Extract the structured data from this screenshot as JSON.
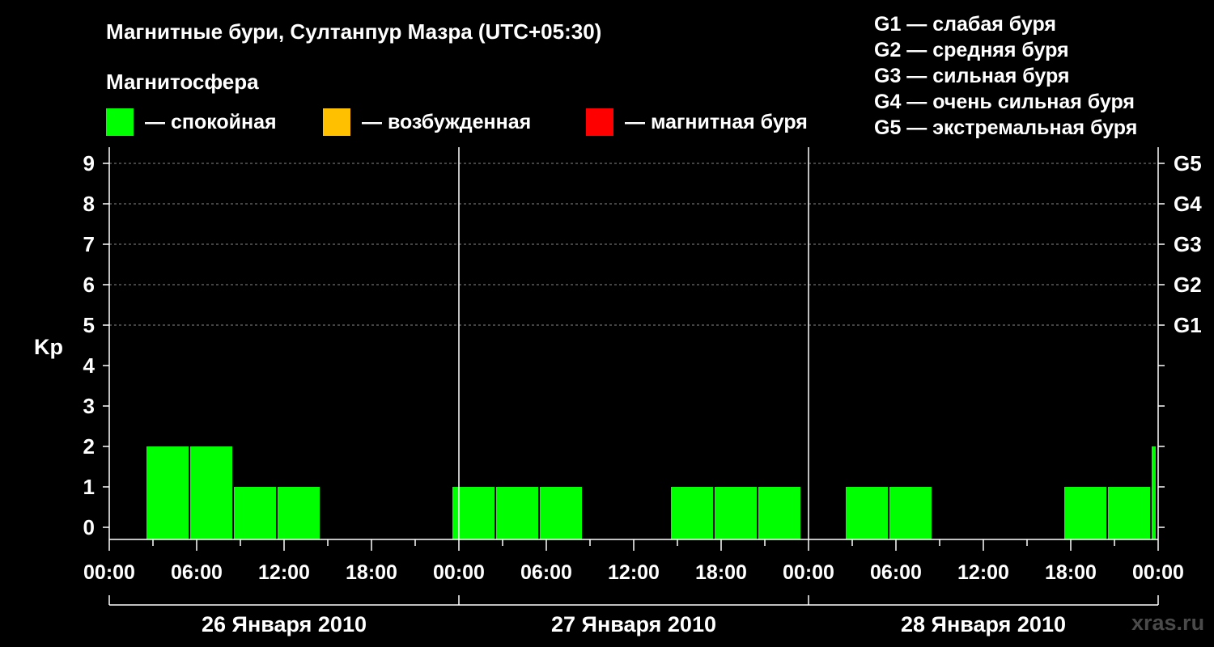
{
  "title": "Магнитные бури, Султанпур Мазра (UTC+05:30)",
  "magnetosphere": {
    "title": "Магнитосфера",
    "items": [
      {
        "label": "— спокойная",
        "color": "#00ff00"
      },
      {
        "label": "— возбужденная",
        "color": "#ffc000"
      },
      {
        "label": "— магнитная буря",
        "color": "#ff0000"
      }
    ]
  },
  "g_scale": [
    "G1 — слабая буря",
    "G2 — средняя буря",
    "G3 — сильная буря",
    "G4 — очень сильная буря",
    "G5 — экстремальная буря"
  ],
  "watermark": "xras.ru",
  "chart_data": {
    "type": "bar",
    "ylabel": "Kp",
    "ylim": [
      0,
      9
    ],
    "yticks": [
      0,
      1,
      2,
      3,
      4,
      5,
      6,
      7,
      8,
      9
    ],
    "right_ticks": [
      {
        "value": 5,
        "label": "G1"
      },
      {
        "value": 6,
        "label": "G2"
      },
      {
        "value": 7,
        "label": "G3"
      },
      {
        "value": 8,
        "label": "G4"
      },
      {
        "value": 9,
        "label": "G5"
      }
    ],
    "grid": "dashed at Kp 5–9",
    "x_tick_labels": [
      "00:00",
      "06:00",
      "12:00",
      "18:00",
      "00:00",
      "06:00",
      "12:00",
      "18:00",
      "00:00",
      "06:00",
      "12:00",
      "18:00",
      "00:00"
    ],
    "days": [
      "26 Января 2010",
      "27 Января 2010",
      "28 Января 2010"
    ],
    "bar_color": "#00ff00",
    "bars": [
      {
        "start_h": 2.5,
        "kp": 2
      },
      {
        "start_h": 5.5,
        "kp": 2
      },
      {
        "start_h": 8.5,
        "kp": 1
      },
      {
        "start_h": 11.5,
        "kp": 1
      },
      {
        "start_h": 14.5,
        "kp": 0
      },
      {
        "start_h": 17.5,
        "kp": 0
      },
      {
        "start_h": 20.5,
        "kp": 0
      },
      {
        "start_h": 23.5,
        "kp": 1
      },
      {
        "start_h": 26.5,
        "kp": 1
      },
      {
        "start_h": 29.5,
        "kp": 1
      },
      {
        "start_h": 32.5,
        "kp": 0
      },
      {
        "start_h": 35.5,
        "kp": 0
      },
      {
        "start_h": 38.5,
        "kp": 1
      },
      {
        "start_h": 41.5,
        "kp": 1
      },
      {
        "start_h": 44.5,
        "kp": 1
      },
      {
        "start_h": 47.5,
        "kp": 0
      },
      {
        "start_h": 50.5,
        "kp": 1
      },
      {
        "start_h": 53.5,
        "kp": 1
      },
      {
        "start_h": 56.5,
        "kp": 0
      },
      {
        "start_h": 59.5,
        "kp": 0
      },
      {
        "start_h": 62.5,
        "kp": 0
      },
      {
        "start_h": 65.5,
        "kp": 1
      },
      {
        "start_h": 68.5,
        "kp": 1
      },
      {
        "start_h": 71.5,
        "kp": 2
      }
    ]
  }
}
